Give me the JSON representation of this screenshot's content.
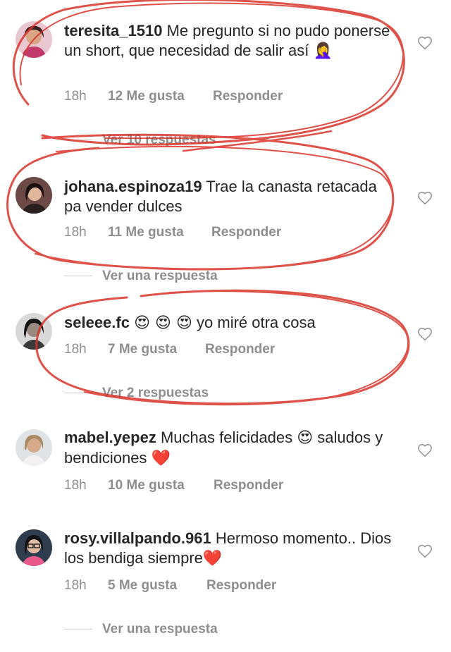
{
  "comments": [
    {
      "username": "teresita_1510",
      "text": "Me pregunto si no pudo ponerse un short, que necesidad de salir así",
      "emoji": "🤦‍♀️",
      "time": "18h",
      "likes": "12 Me gusta",
      "reply": "Responder",
      "replies": "Ver 10 respuestas"
    },
    {
      "username": "johana.espinoza19",
      "text": "Trae la canasta retacada pa vender dulces",
      "time": "18h",
      "likes": "11 Me gusta",
      "reply": "Responder",
      "replies": "Ver una respuesta"
    },
    {
      "username": "seleee.fc",
      "emoji": "😍 😍 😍",
      "text": "yo miré otra cosa",
      "time": "18h",
      "likes": "7 Me gusta",
      "reply": "Responder",
      "replies": "Ver 2 respuestas"
    },
    {
      "username": "mabel.yepez",
      "text": "Muchas felicidades",
      "emoji": "😍",
      "text2": "saludos y bendiciones",
      "emoji2": "❤️",
      "time": "18h",
      "likes": "10 Me gusta",
      "reply": "Responder"
    },
    {
      "username": "rosy.villalpando.961",
      "text": "Hermoso momento.. Dios los bendiga siempre",
      "emoji": "❤️",
      "time": "18h",
      "likes": "5 Me gusta",
      "reply": "Responder",
      "replies": "Ver una respuesta"
    }
  ],
  "colors": {
    "text": "#262626",
    "meta": "#8e8e8e",
    "annotation": "#d9342b"
  },
  "icons": [
    "heart-outline-icon",
    "heart-emoji",
    "heart-eyes-emoji",
    "facepalm-emoji"
  ]
}
